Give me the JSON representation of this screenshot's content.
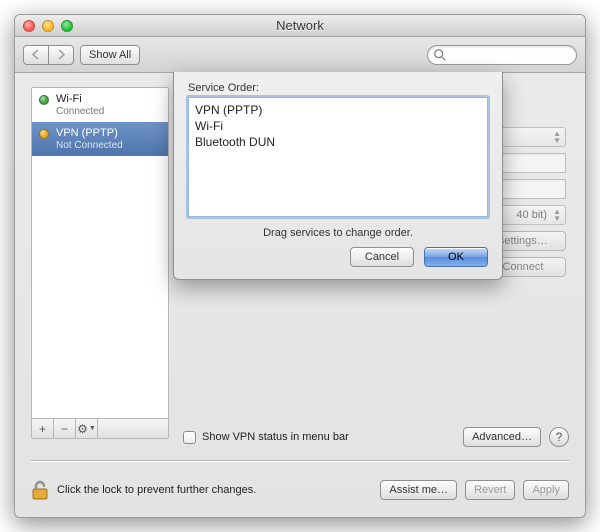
{
  "window": {
    "title": "Network"
  },
  "toolbar": {
    "back_aria": "Back",
    "forward_aria": "Forward",
    "show_all_label": "Show All",
    "search_placeholder": ""
  },
  "sidebar": {
    "services": [
      {
        "name": "Wi-Fi",
        "status": "Connected",
        "status_color": "#3fa83f",
        "selected": false
      },
      {
        "name": "VPN (PPTP)",
        "status": "Not Connected",
        "status_color": "#e6a918",
        "selected": true
      }
    ],
    "add_label": "+",
    "remove_label": "−",
    "action_label": "⚙"
  },
  "detail": {
    "encryption_suffix": "40 bit)",
    "auth_settings_label": "Authentication Settings…",
    "connect_label": "Connect",
    "show_status_label": "Show VPN status in menu bar",
    "advanced_label": "Advanced…"
  },
  "footer": {
    "lock_text": "Click the lock to prevent further changes.",
    "assist_label": "Assist me…",
    "revert_label": "Revert",
    "apply_label": "Apply"
  },
  "sheet": {
    "label": "Service Order:",
    "items": [
      "VPN (PPTP)",
      "Wi-Fi",
      "Bluetooth DUN"
    ],
    "hint": "Drag services to change order.",
    "cancel_label": "Cancel",
    "ok_label": "OK"
  }
}
